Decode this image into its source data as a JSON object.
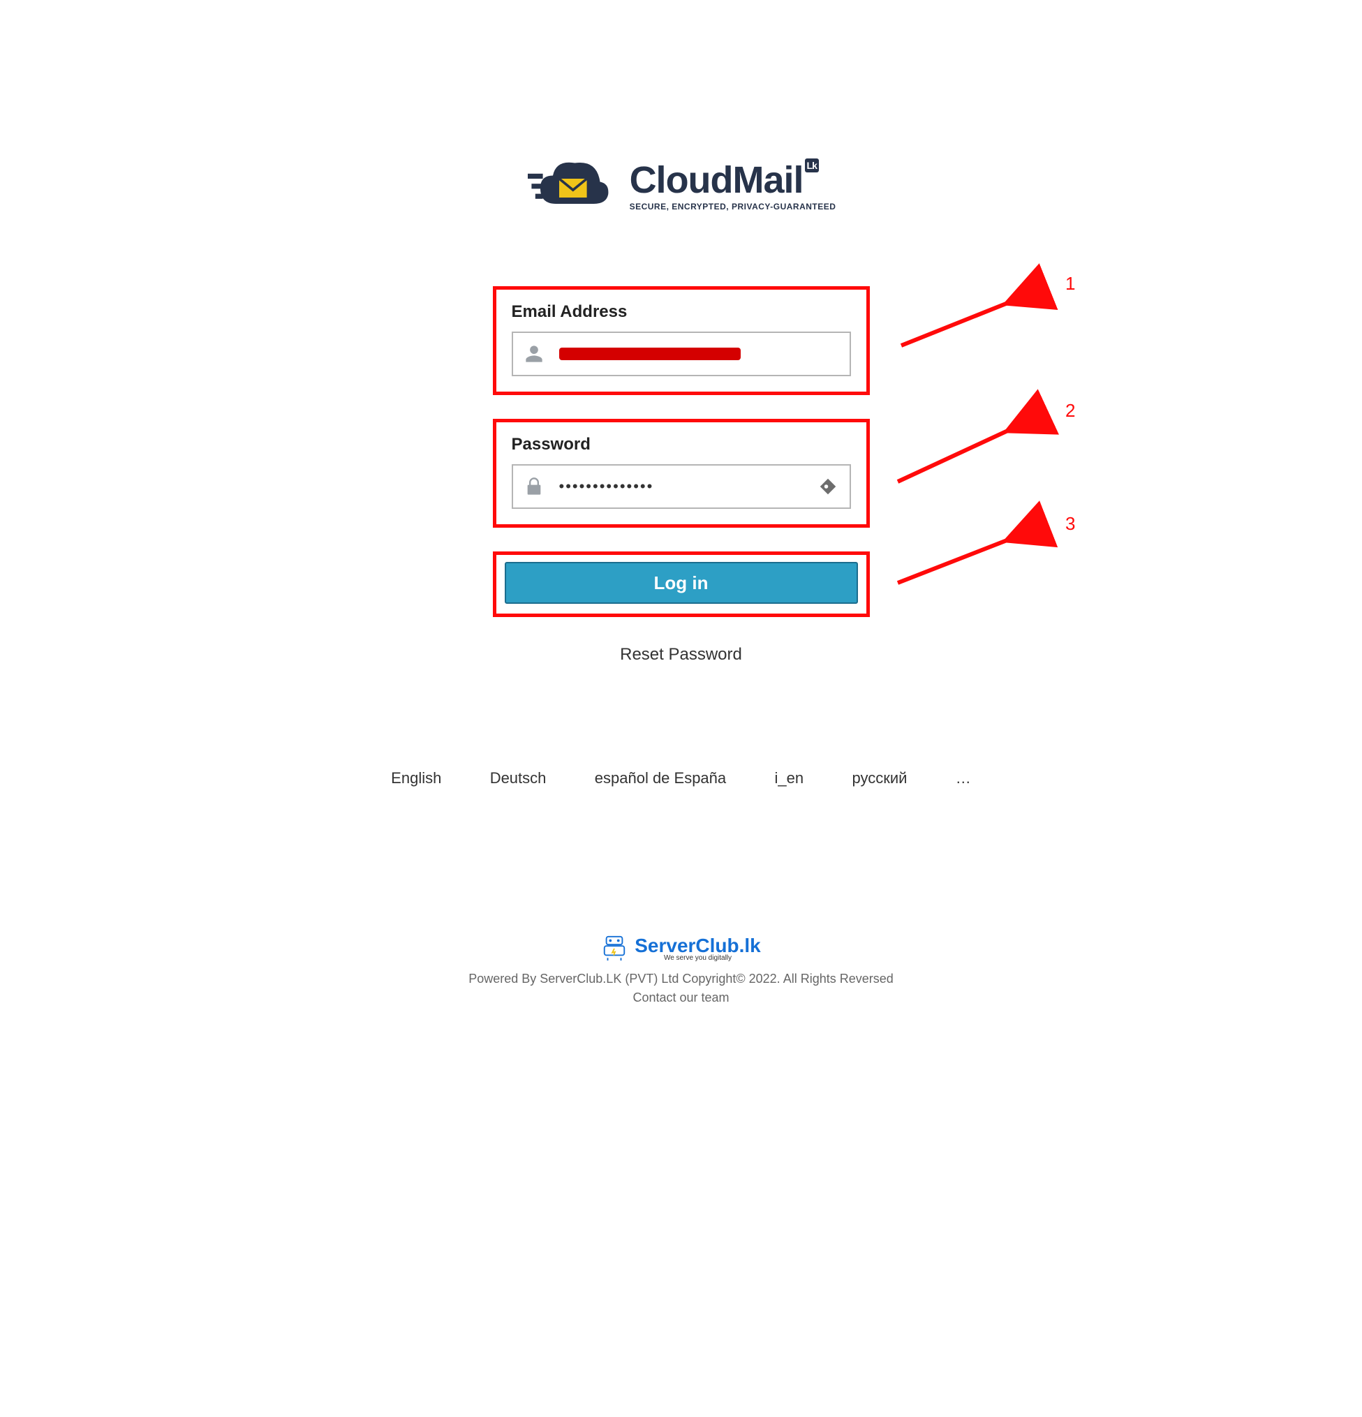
{
  "brand": {
    "name": "CloudMail",
    "badge": "Lk",
    "tagline": "SECURE, ENCRYPTED, PRIVACY-GUARANTEED"
  },
  "form": {
    "email_label": "Email Address",
    "password_label": "Password",
    "password_value": "••••••••••••••",
    "login_label": "Log in",
    "reset_label": "Reset Password"
  },
  "annotations": {
    "n1": "1",
    "n2": "2",
    "n3": "3"
  },
  "languages": [
    "English",
    "Deutsch",
    "español de España",
    "i_en",
    "русский",
    "…"
  ],
  "footer": {
    "logo_name": "ServerClub.lk",
    "logo_tag": "We serve you digitally",
    "line1": "Powered By ServerClub.LK (PVT) Ltd Copyright© 2022. All Rights Reversed",
    "line2": "Contact our team"
  }
}
